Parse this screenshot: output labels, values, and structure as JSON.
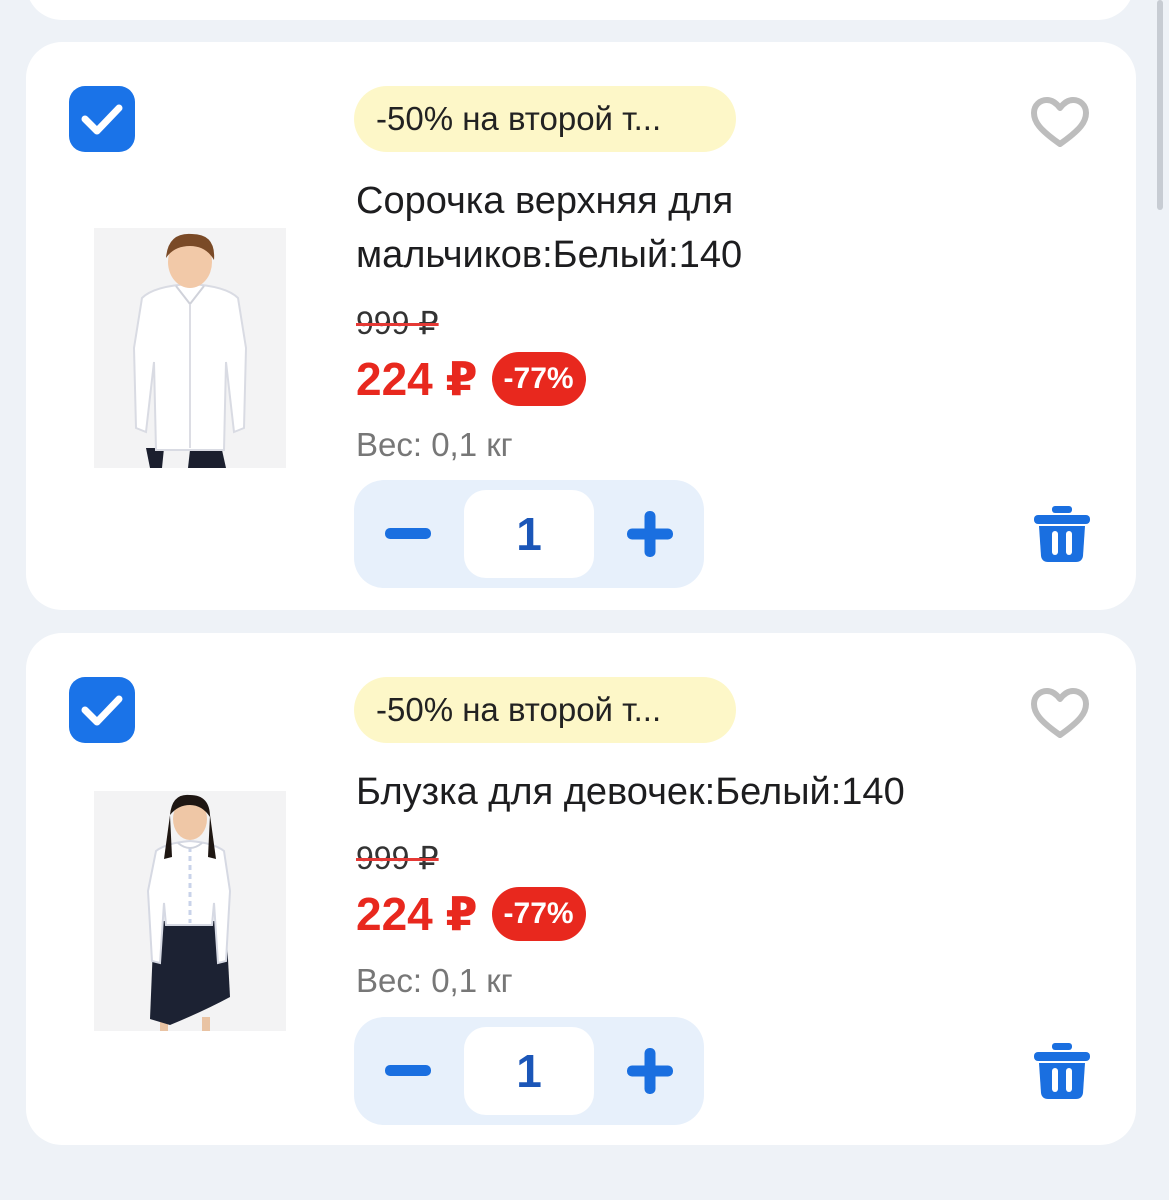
{
  "colors": {
    "accent": "#1a73e8",
    "price_red": "#e8281e",
    "promo_bg": "#fdf7c8",
    "stepper_bg": "#e7f0fb"
  },
  "cart_items": [
    {
      "selected": true,
      "promo": "-50% на второй т...",
      "title_line1": "Сорочка верхняя для",
      "title_line2": "мальчиков:Белый:140",
      "old_price": "999 ₽",
      "new_price": "224 ₽",
      "discount": "-77%",
      "weight": "Вес: 0,1 кг",
      "quantity": "1",
      "image": "boy-white-shirt"
    },
    {
      "selected": true,
      "promo": "-50% на второй т...",
      "title_line1": "Блузка для девочек:Белый:140",
      "title_line2": "",
      "old_price": "999 ₽",
      "new_price": "224 ₽",
      "discount": "-77%",
      "weight": "Вес: 0,1 кг",
      "quantity": "1",
      "image": "girl-white-blouse"
    }
  ],
  "icons": {
    "checkbox": "check-icon",
    "favorite": "heart-icon",
    "decrease": "minus-icon",
    "increase": "plus-icon",
    "delete": "trash-icon"
  }
}
